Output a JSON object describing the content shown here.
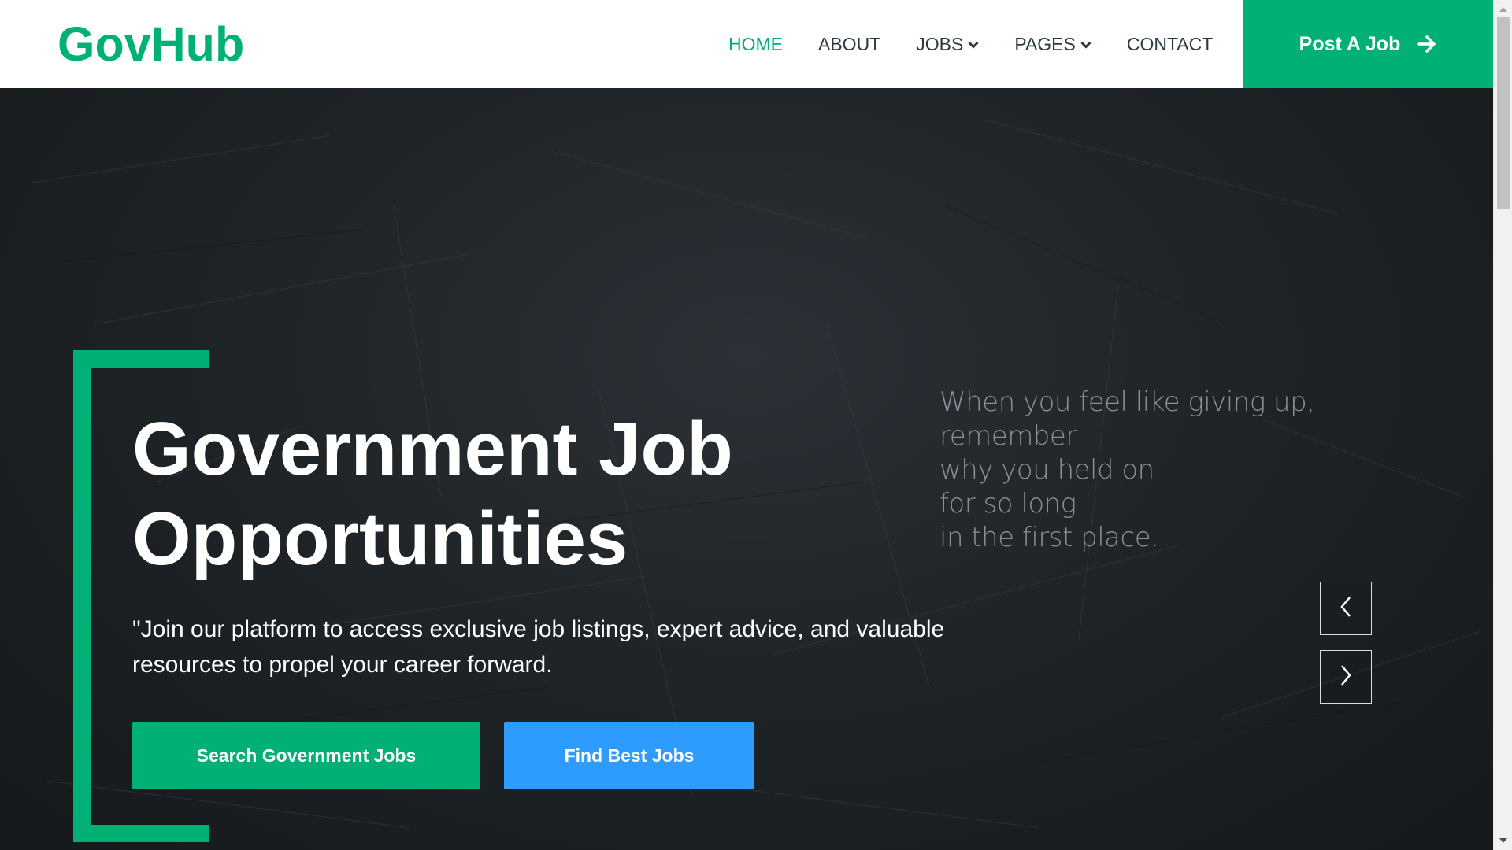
{
  "header": {
    "brand": "GovHub",
    "nav": [
      {
        "label": "HOME",
        "active": true
      },
      {
        "label": "ABOUT"
      },
      {
        "label": "JOBS",
        "dropdown": true
      },
      {
        "label": "PAGES",
        "dropdown": true
      },
      {
        "label": "CONTACT"
      }
    ],
    "post_job_label": "Post A Job"
  },
  "hero": {
    "title_line1": "Government Job",
    "title_line2": "Opportunities",
    "subtitle_line1": "\"Join our platform to access exclusive job listings, expert advice, and valuable",
    "subtitle_line2": "resources to propel your career forward.",
    "search_button": "Search Government Jobs",
    "find_button": "Find Best Jobs",
    "quote_lines": [
      "When you feel like giving up,",
      "remember",
      "why you held on",
      "for so long",
      "in the first place."
    ]
  },
  "icons": {
    "post_job": "arrow-right-icon",
    "dropdown": "chevron-down-icon",
    "slider_prev": "chevron-left-icon",
    "slider_next": "chevron-right-icon"
  },
  "colors": {
    "brand_green": "#00b074",
    "accent_blue": "#2e9bff",
    "hero_background": "#1f2428",
    "nav_text": "#2b3940"
  }
}
